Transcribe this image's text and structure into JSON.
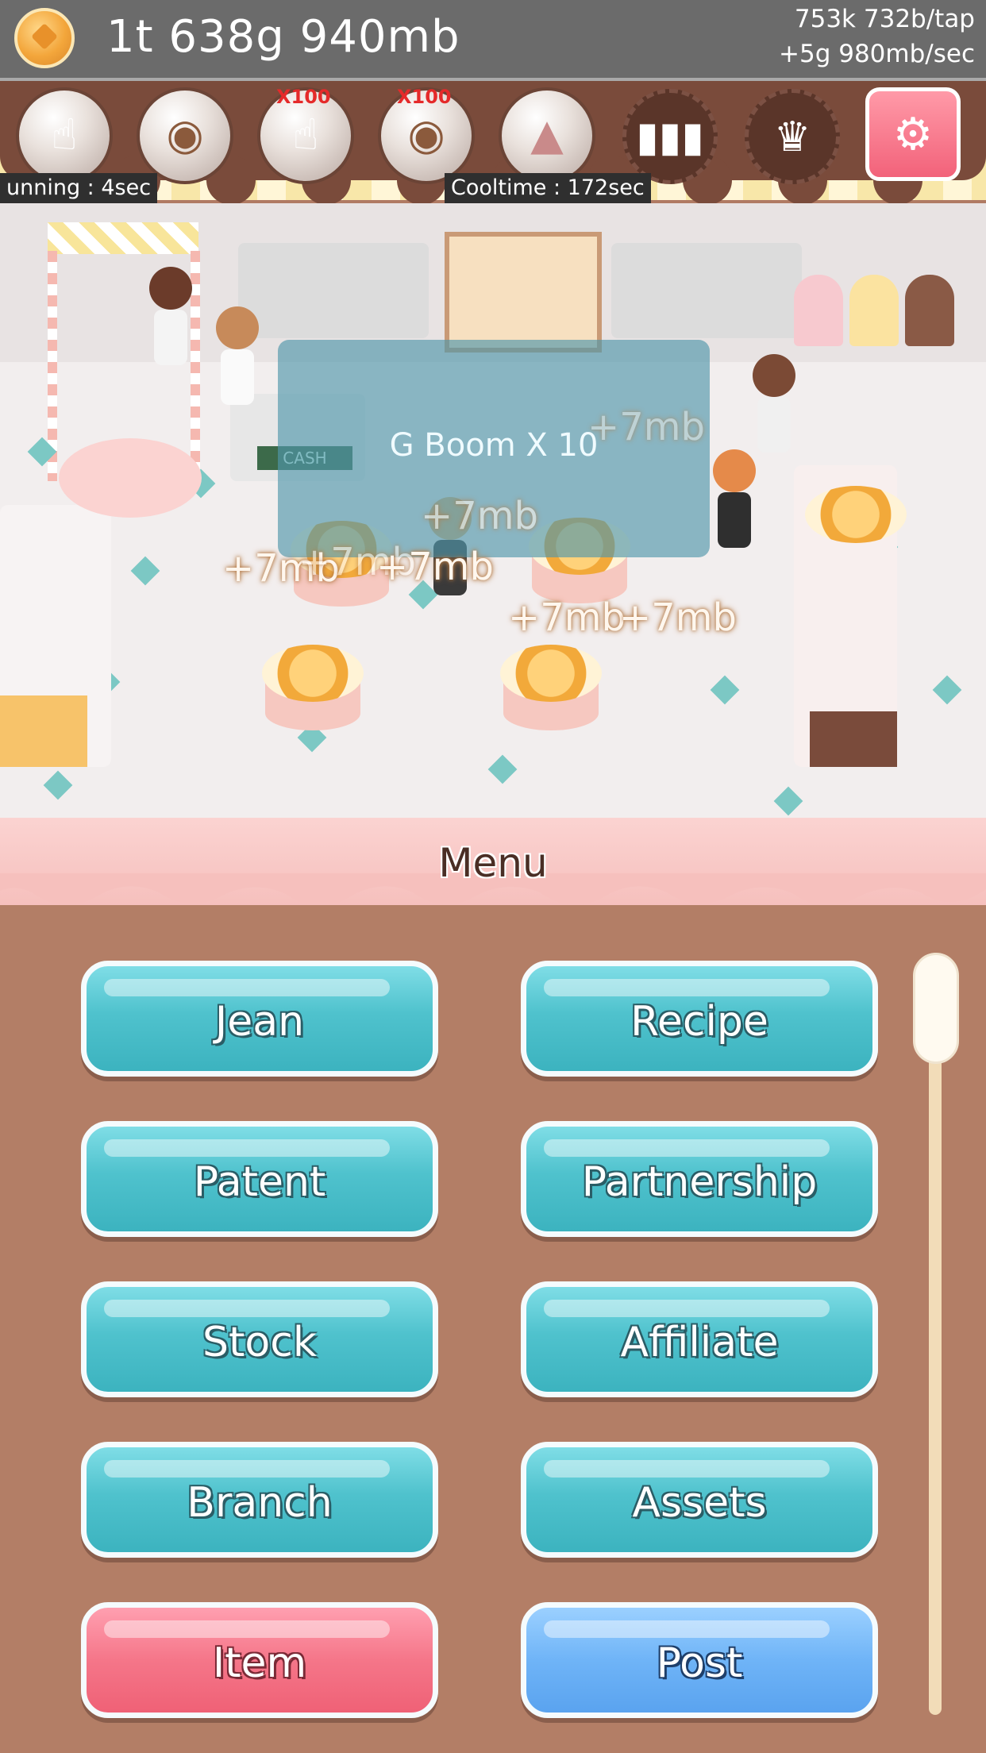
{
  "currency": {
    "coin_icon": "coin-icon",
    "total": "1t 638g 940mb",
    "per_tap": "753k 732b/tap",
    "per_sec": "+5g 980mb/sec"
  },
  "skills": {
    "running_timer": "unning : 4sec",
    "cooltime_timer": "Cooltime : 172sec",
    "x100_label": "X100"
  },
  "scene": {
    "effect_text": "G Boom X 10",
    "cash_sign": "CASH",
    "floating": [
      "+7mb",
      "+7mb",
      "+7mb",
      "+7mb",
      "+7mb",
      "+7mb",
      "+7mb",
      "+7mb"
    ]
  },
  "menu": {
    "title": "Menu",
    "buttons": [
      "Jean",
      "Recipe",
      "Patent",
      "Partnership",
      "Stock",
      "Affiliate",
      "Branch",
      "Assets",
      "Item",
      "Post"
    ]
  },
  "colors": {
    "teal_button": "#4fc2cd",
    "item_button": "#f57689",
    "post_button": "#6fb4f7",
    "menu_background": "#b37e66",
    "awning_brown": "#7a4b3b"
  }
}
